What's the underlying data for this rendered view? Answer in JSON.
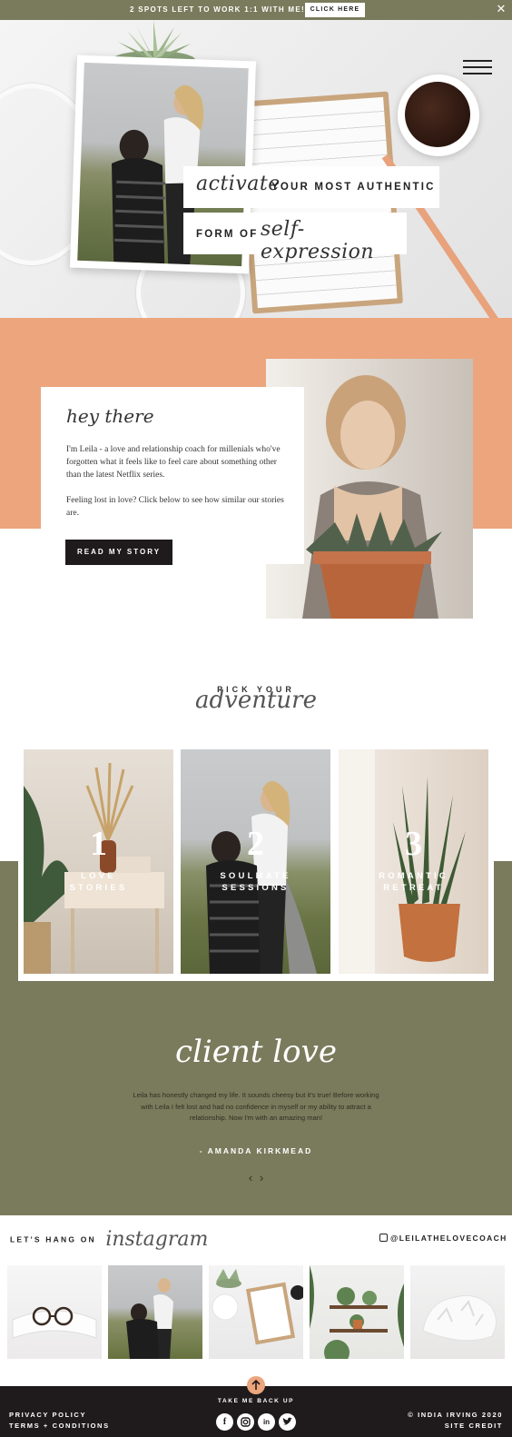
{
  "announcement": {
    "message": "2 SPOTS LEFT TO WORK 1:1 WITH ME!",
    "button_label": "CLICK HERE",
    "close_glyph": "✕"
  },
  "hero": {
    "tagline_line1_script": "activate",
    "tagline_line1_caps": "YOUR MOST AUTHENTIC",
    "tagline_line2_caps": "FORM OF",
    "tagline_line2_script": "self-expression"
  },
  "about": {
    "greeting": "hey there",
    "paragraph1": "I'm Leila - a love and relationship coach for millenials who've forgotten what it feels like to feel care about something other than the latest Netflix series.",
    "paragraph2": "Feeling lost in love? Click below to see how similar our stories are.",
    "button_label": "READ MY STORY"
  },
  "adventure": {
    "small": "PICK YOUR",
    "script": "adventure",
    "cards": [
      {
        "number": "1",
        "line1": "LOVE",
        "line2": "STORIES"
      },
      {
        "number": "2",
        "line1": "SOULMATE",
        "line2": "SESSIONS"
      },
      {
        "number": "3",
        "line1": "ROMANTIC",
        "line2": "RETREAT"
      }
    ]
  },
  "testimonial": {
    "title": "client love",
    "quote": "Leila has honestly changed my life. It sounds cheesy but it's true! Before working with Leila I felt lost and had no confidence in myself or my ability to attract a relationship. Now I'm with an amazing man!",
    "author": "- AMANDA KIRKMEAD",
    "prev_glyph": "‹",
    "next_glyph": "›"
  },
  "instagram": {
    "caption": "LET'S HANG ON",
    "script": "instagram",
    "handle": "@LEILATHELOVECOACH"
  },
  "footer": {
    "back_up": "TAKE ME BACK UP",
    "privacy": "PRIVACY POLICY",
    "terms": "TERMS + CONDITIONS",
    "copyright": "© INDIA IRVING 2020",
    "credit": "SITE CREDIT",
    "social": [
      "f",
      "ig",
      "in",
      "tw"
    ]
  },
  "colors": {
    "olive": "#7a7b5c",
    "peach": "#eca57c",
    "dark": "#1f1a1c"
  }
}
